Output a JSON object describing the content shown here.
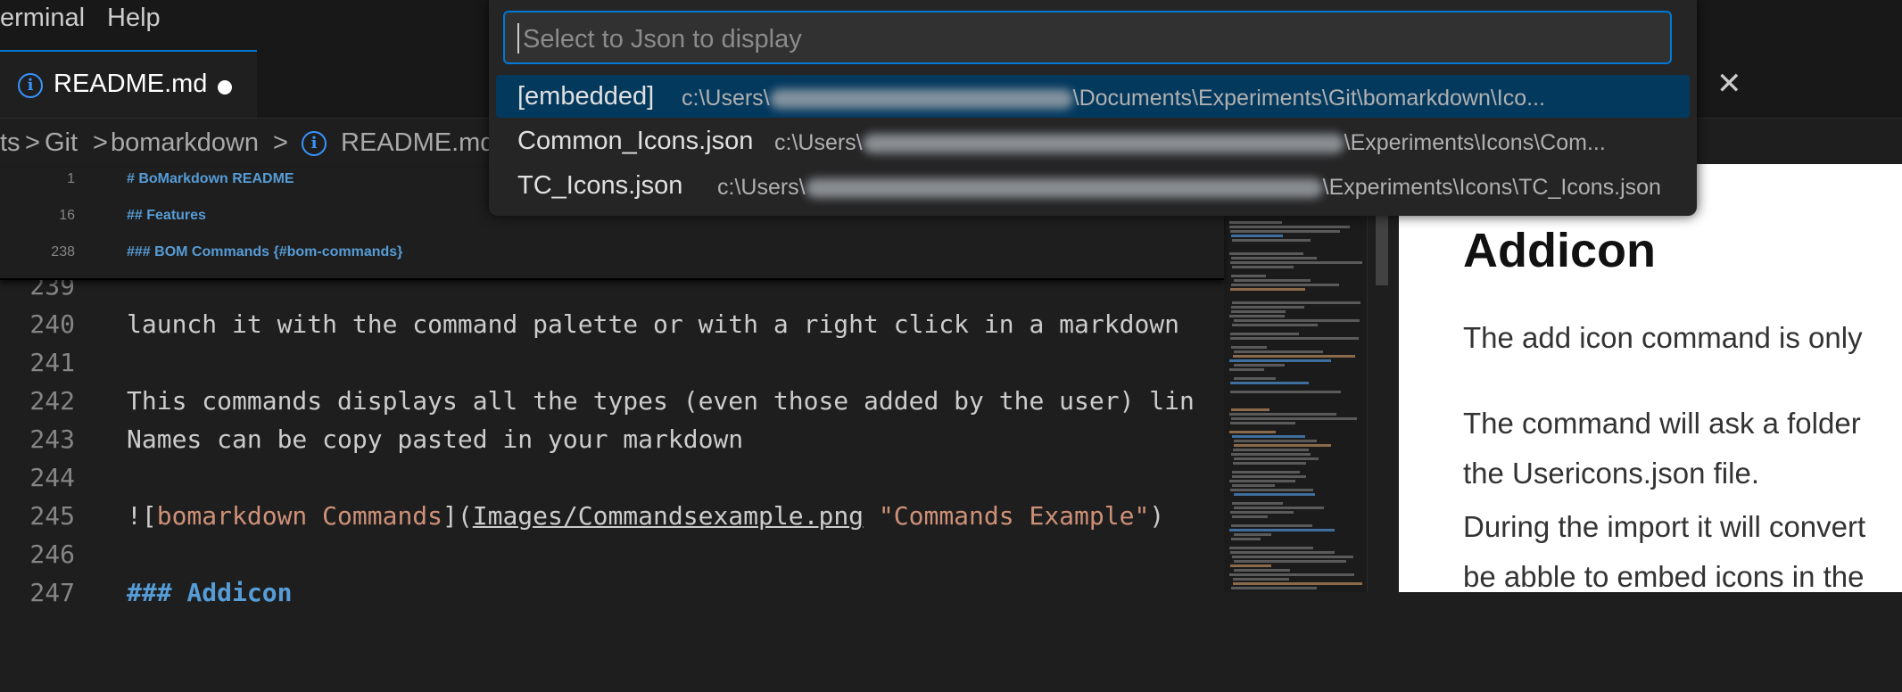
{
  "menu": {
    "terminal": "erminal",
    "help": "Help"
  },
  "tabs": [
    {
      "label": "README.md",
      "icon": "info-icon",
      "dirty": true
    }
  ],
  "breadcrumb": {
    "items": [
      "ts",
      "Git",
      "bomarkdown",
      "README.md"
    ],
    "separator": ">"
  },
  "editor": {
    "sticky": [
      {
        "ln": "1",
        "text": "# BoMarkdown README"
      },
      {
        "ln": "16",
        "text": "## Features"
      },
      {
        "ln": "238",
        "text": "### BOM Commands {#bom-commands}"
      }
    ],
    "lines": [
      {
        "ln": "239",
        "text": ""
      },
      {
        "ln": "240",
        "text": "launch it with the command palette or with a right click in a markdown"
      },
      {
        "ln": "241",
        "text": ""
      },
      {
        "ln": "242",
        "text": "This commands displays all the types (even those added by the user) lin"
      },
      {
        "ln": "243",
        "text": "Names can be copy pasted in your markdown"
      },
      {
        "ln": "244",
        "text": ""
      },
      {
        "ln": "245",
        "pre": "![",
        "alt": "bomarkdown Commands",
        "mid": "](",
        "path": "Images/Commandsexample.png",
        "title": "\"Commands Example\"",
        "end": ")"
      },
      {
        "ln": "246",
        "text": ""
      },
      {
        "ln": "247",
        "text": "### Addicon"
      }
    ]
  },
  "preview": {
    "heading": "Addicon",
    "p1": "The add icon command is only",
    "p2": "The command will ask a folder",
    "p3": "the Usericons.json file.",
    "p4": "During the import it will convert",
    "p5": "be abble to embed icons in the"
  },
  "palette": {
    "placeholder": "Select to Json to display",
    "items": [
      {
        "label": "[embedded]",
        "desc_start": "c:\\Users\\",
        "desc_end": "\\Documents\\Experiments\\Git\\bomarkdown\\Ico...",
        "active": true
      },
      {
        "label": "Common_Icons.json",
        "desc_start": "c:\\Users\\",
        "desc_end": "\\Experiments\\Icons\\Com...",
        "active": false
      },
      {
        "label": "TC_Icons.json",
        "desc_start": "c:\\Users\\",
        "desc_end": "\\Experiments\\Icons\\TC_Icons.json",
        "active": false
      }
    ]
  },
  "colors": {
    "accent": "#0078d4",
    "heading": "#569cd6",
    "string": "#ce9178",
    "active_item": "#04395e"
  }
}
